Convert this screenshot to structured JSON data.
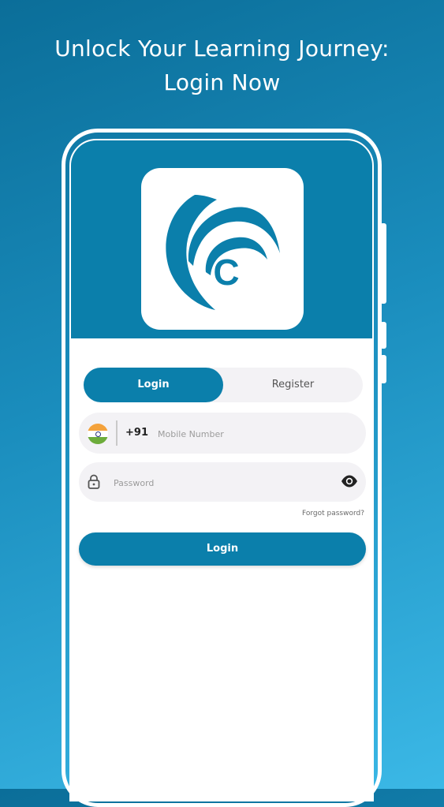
{
  "headline": {
    "line1": "Unlock Your Learning Journey:",
    "line2": "Login Now"
  },
  "logo": {
    "letter": "C",
    "icon": "app-logo-icon"
  },
  "tabs": [
    {
      "label": "Login",
      "active": true
    },
    {
      "label": "Register",
      "active": false
    }
  ],
  "mobile": {
    "country_code": "+91",
    "flag_icon": "india-flag-icon",
    "placeholder": "Mobile Number",
    "value": ""
  },
  "password": {
    "placeholder": "Password",
    "value": "",
    "lock_icon": "lock-icon",
    "toggle_icon": "eye-icon"
  },
  "forgot_password": "Forgot password?",
  "login_button": "Login",
  "colors": {
    "primary": "#0b7fab",
    "field_bg": "#f3f2f5",
    "background_start": "#0b6e99",
    "background_end": "#3bb8e6"
  }
}
